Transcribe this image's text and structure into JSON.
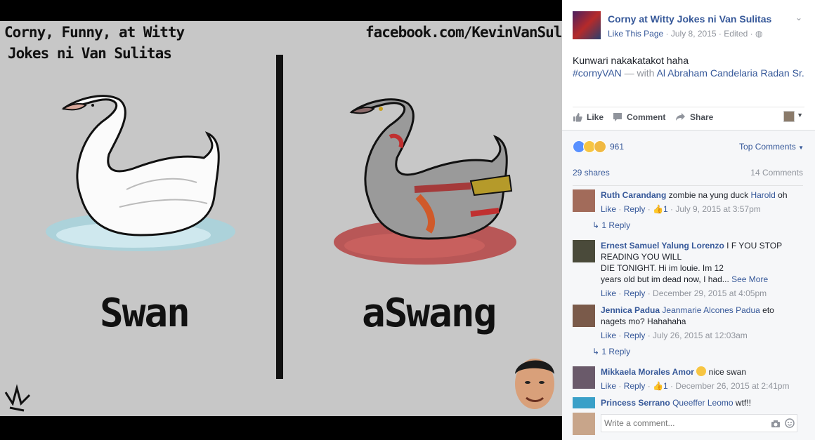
{
  "photo": {
    "caption_line1": "Corny, Funny, at Witty",
    "caption_line2": "Jokes ni Van Sulitas",
    "caption_right": "facebook.com/KevinVanSulitas",
    "word_left": "Swan",
    "word_right": "aSwang"
  },
  "post": {
    "page_name": "Corny at Witty Jokes ni Van Sulitas",
    "like_page": "Like This Page",
    "date": "July 8, 2015",
    "edited": "Edited",
    "text": "Kunwari nakakatakot haha",
    "hashtag": "#cornyVAN",
    "with_label": "— with",
    "tagged": "Al Abraham Candelaria Radan Sr.",
    "actions": {
      "like": "Like",
      "comment": "Comment",
      "share": "Share"
    }
  },
  "stats": {
    "reaction_count": "961",
    "top_comments": "Top Comments",
    "shares": "29 shares",
    "comments": "14 Comments"
  },
  "comments": [
    {
      "name": "Ruth Carandang",
      "text": "zombie na yung duck",
      "tag": "Harold",
      "tail": "oh",
      "like": "Like",
      "reply": "Reply",
      "likes": "1",
      "date": "July 9, 2015 at 3:57pm",
      "replies": "1 Reply"
    },
    {
      "name": "Ernest Samuel Yalung Lorenzo",
      "text_lines": [
        "I F YOU STOP",
        "READING YOU WILL",
        "DIE TONIGHT. Hi im louie. Im 12",
        "years old but im dead now, I had..."
      ],
      "see_more": "See More",
      "like": "Like",
      "reply": "Reply",
      "date": "December 29, 2015 at 4:05pm"
    },
    {
      "name": "Jennica Padua",
      "tag": "Jeanmarie Alcones Padua",
      "text": "eto",
      "text2": "nagets mo? Hahahaha",
      "like": "Like",
      "reply": "Reply",
      "date": "July 26, 2015 at 12:03am",
      "replies": "1 Reply"
    },
    {
      "name": "Mikkaela Morales Amor",
      "text": "nice swan",
      "like": "Like",
      "reply": "Reply",
      "likes": "1",
      "date": "December 26, 2015 at 2:41pm"
    },
    {
      "name": "Princess Serrano",
      "tag": "Queeffer Leomo",
      "text": "wtf!!"
    }
  ],
  "composer": {
    "placeholder": "Write a comment..."
  },
  "colors": {
    "link": "#365899",
    "muted": "#90949c",
    "like_blue": "#5890ff",
    "haha_yellow": "#f7c542"
  }
}
